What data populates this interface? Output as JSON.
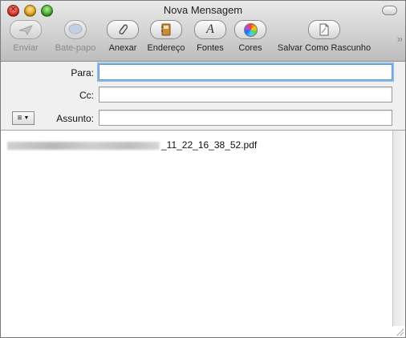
{
  "window": {
    "title": "Nova Mensagem"
  },
  "toolbar": {
    "items": [
      {
        "label": "Enviar",
        "icon": "send-icon",
        "enabled": false
      },
      {
        "label": "Bate-papo",
        "icon": "chat-icon",
        "enabled": false
      },
      {
        "label": "Anexar",
        "icon": "paperclip-icon",
        "enabled": true
      },
      {
        "label": "Endereço",
        "icon": "address-book-icon",
        "enabled": true
      },
      {
        "label": "Fontes",
        "icon": "fonts-icon",
        "enabled": true
      },
      {
        "label": "Cores",
        "icon": "color-wheel-icon",
        "enabled": true
      },
      {
        "label": "Salvar Como Rascunho",
        "icon": "draft-icon",
        "enabled": true
      }
    ]
  },
  "fields": {
    "to_label": "Para:",
    "to_value": "",
    "cc_label": "Cc:",
    "cc_value": "",
    "subject_label": "Assunto:",
    "subject_value": ""
  },
  "body": {
    "attachment_name": "_11_22_16_38_52.pdf"
  }
}
